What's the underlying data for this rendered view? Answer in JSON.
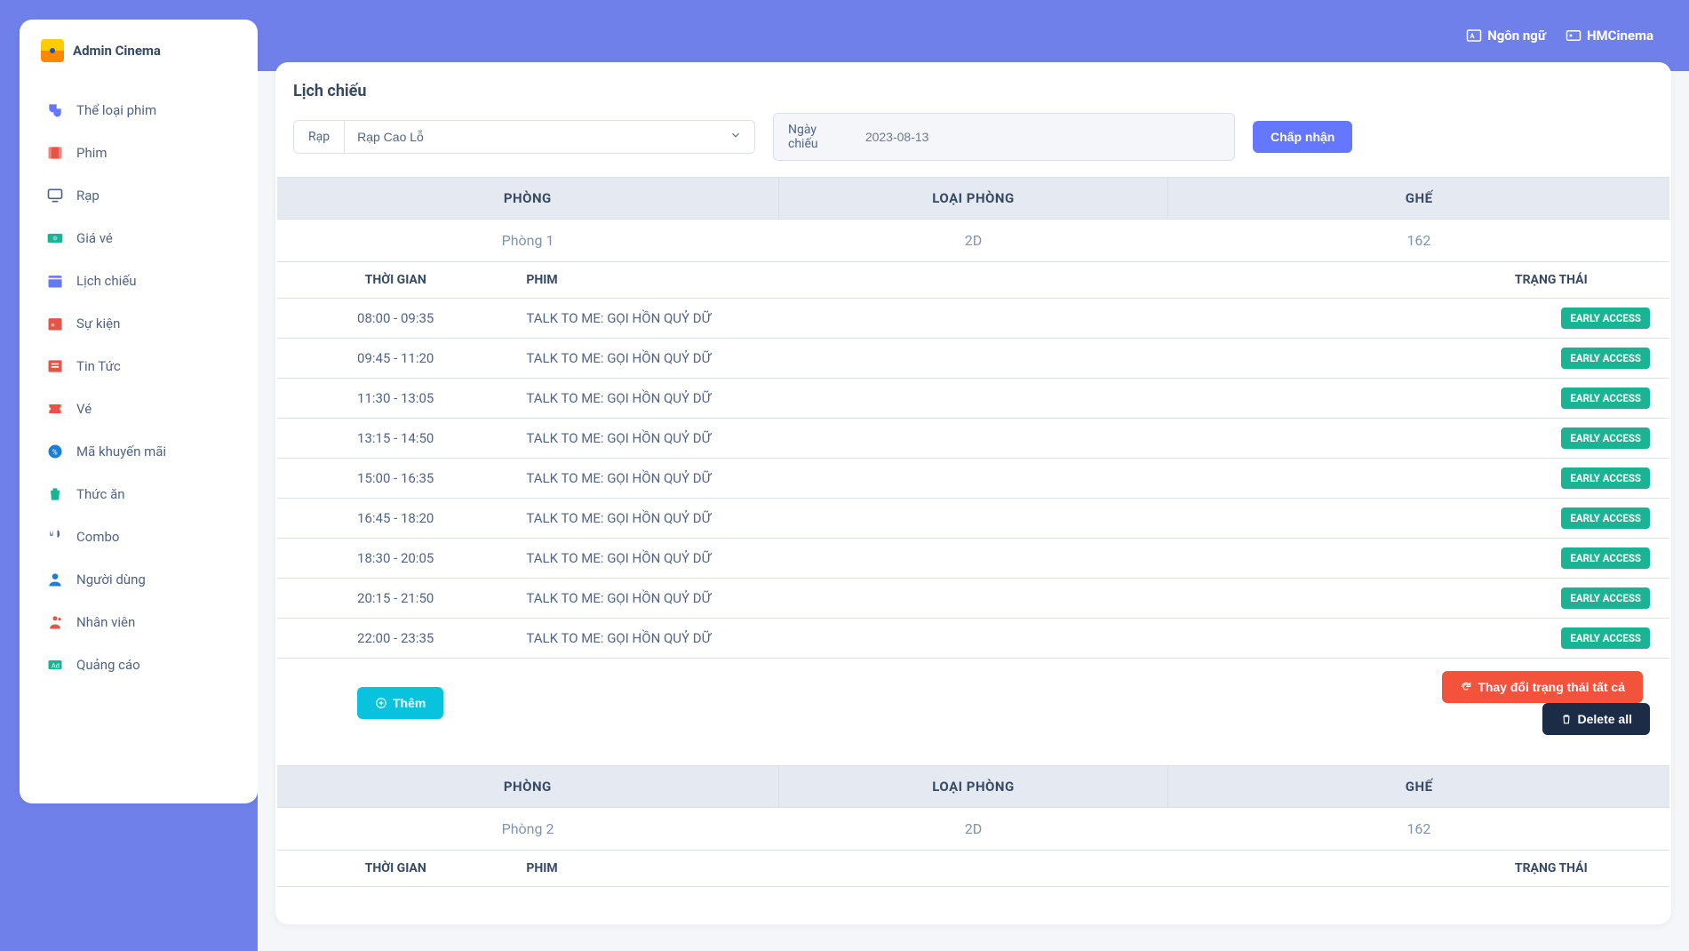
{
  "brand": {
    "title": "Admin Cinema"
  },
  "topbar": {
    "language": "Ngôn ngữ",
    "account": "HMCinema"
  },
  "sidebar": {
    "items": [
      {
        "label": "Thể loại phim",
        "icon": "masks-icon",
        "color": "ic-purple"
      },
      {
        "label": "Phim",
        "icon": "film-icon",
        "color": "ic-red"
      },
      {
        "label": "Rạp",
        "icon": "monitor-icon",
        "color": "ic-purple"
      },
      {
        "label": "Giá vé",
        "icon": "money-icon",
        "color": "ic-green"
      },
      {
        "label": "Lịch chiếu",
        "icon": "calendar-icon",
        "color": "ic-purple"
      },
      {
        "label": "Sự kiện",
        "icon": "calendar-event-icon",
        "color": "ic-red"
      },
      {
        "label": "Tin Tức",
        "icon": "news-icon",
        "color": "ic-red"
      },
      {
        "label": "Vé",
        "icon": "ticket-icon",
        "color": "ic-red"
      },
      {
        "label": "Mã khuyến mãi",
        "icon": "coupon-icon",
        "color": "ic-blue"
      },
      {
        "label": "Thức ăn",
        "icon": "trash-icon",
        "color": "ic-green"
      },
      {
        "label": "Combo",
        "icon": "utensils-icon",
        "color": "ic-gray"
      },
      {
        "label": "Người dùng",
        "icon": "user-icon",
        "color": "ic-blue"
      },
      {
        "label": "Nhân viên",
        "icon": "staff-icon",
        "color": "ic-red"
      },
      {
        "label": "Quảng cáo",
        "icon": "ad-icon",
        "color": "ic-green"
      }
    ]
  },
  "page": {
    "title": "Lịch chiếu",
    "filter": {
      "theater_label": "Rạp",
      "theater_value": "Rạp Cao Lỗ",
      "date_label": "Ngày chiếu",
      "date_value": "2023-08-13",
      "submit": "Chấp nhận"
    },
    "room_headers": {
      "room": "PHÒNG",
      "type": "LOẠI PHÒNG",
      "seat": "GHẾ"
    },
    "sched_headers": {
      "time": "THỜI GIAN",
      "movie": "PHIM",
      "status": "TRẠNG THÁI"
    },
    "actions": {
      "add": "Thêm",
      "change_all": "Thay đổi trạng thái tất cả",
      "delete_all": "Delete all"
    },
    "badge_label": "EARLY ACCESS",
    "rooms": [
      {
        "name": "Phòng 1",
        "type": "2D",
        "seats": "162",
        "rows": [
          {
            "time": "08:00 - 09:35",
            "movie": "TALK TO ME: GỌI HỒN QUỶ DỮ"
          },
          {
            "time": "09:45 - 11:20",
            "movie": "TALK TO ME: GỌI HỒN QUỶ DỮ"
          },
          {
            "time": "11:30 - 13:05",
            "movie": "TALK TO ME: GỌI HỒN QUỶ DỮ"
          },
          {
            "time": "13:15 - 14:50",
            "movie": "TALK TO ME: GỌI HỒN QUỶ DỮ"
          },
          {
            "time": "15:00 - 16:35",
            "movie": "TALK TO ME: GỌI HỒN QUỶ DỮ"
          },
          {
            "time": "16:45 - 18:20",
            "movie": "TALK TO ME: GỌI HỒN QUỶ DỮ"
          },
          {
            "time": "18:30 - 20:05",
            "movie": "TALK TO ME: GỌI HỒN QUỶ DỮ"
          },
          {
            "time": "20:15 - 21:50",
            "movie": "TALK TO ME: GỌI HỒN QUỶ DỮ"
          },
          {
            "time": "22:00 - 23:35",
            "movie": "TALK TO ME: GỌI HỒN QUỶ DỮ"
          }
        ]
      },
      {
        "name": "Phòng 2",
        "type": "2D",
        "seats": "162",
        "rows": []
      }
    ]
  }
}
